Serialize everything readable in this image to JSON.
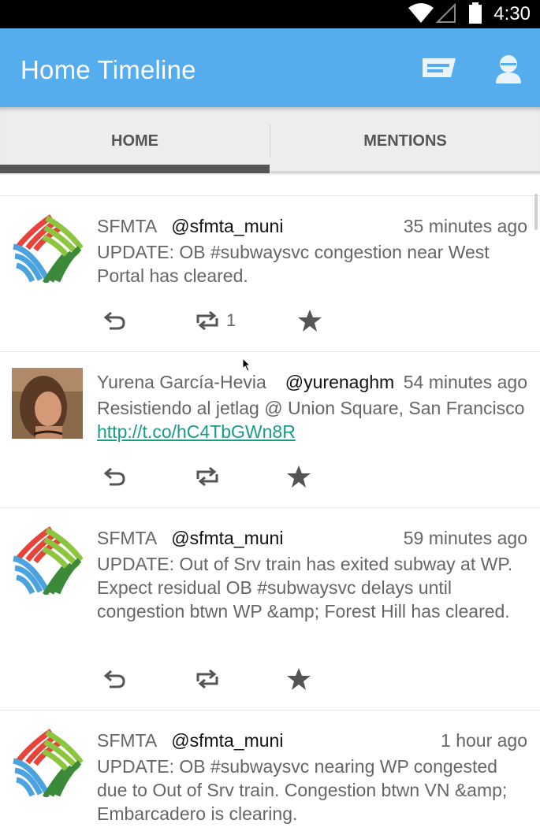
{
  "status_bar": {
    "time": "4:30"
  },
  "app_bar": {
    "title": "Home Timeline",
    "color": "#55adee",
    "icons": [
      "compose-icon",
      "profile-icon"
    ]
  },
  "tabs": [
    {
      "label": "HOME",
      "selected": true
    },
    {
      "label": "MENTIONS",
      "selected": false
    }
  ],
  "tweets": [
    {
      "name": "SFMTA",
      "handle": "@sfmta_muni",
      "time": "35 minutes ago",
      "text": "UPDATE: OB #subwaysvc congestion near West Portal has cleared.",
      "link": "",
      "retweet_count": "1"
    },
    {
      "name": "Yurena García-Hevia",
      "handle": "@yurenaghm",
      "time": "54 minutes ago",
      "text": "Resistiendo al jetlag @ Union Square, San Francisco ",
      "link": "http://t.co/hC4TbGWn8R",
      "retweet_count": ""
    },
    {
      "name": "SFMTA",
      "handle": "@sfmta_muni",
      "time": "59 minutes ago",
      "text": "UPDATE: Out of Srv train has exited subway at WP. Expect residual OB #subwaysvc delays until congestion btwn WP &amp; Forest Hill has cleared.",
      "link": "",
      "retweet_count": ""
    },
    {
      "name": "SFMTA",
      "handle": "@sfmta_muni",
      "time": "1 hour ago",
      "text": "UPDATE: OB #subwaysvc nearing WP congested due to Out of Srv train. Congestion btwn VN &amp; Embarcadero is clearing.",
      "link": "",
      "retweet_count": ""
    }
  ]
}
